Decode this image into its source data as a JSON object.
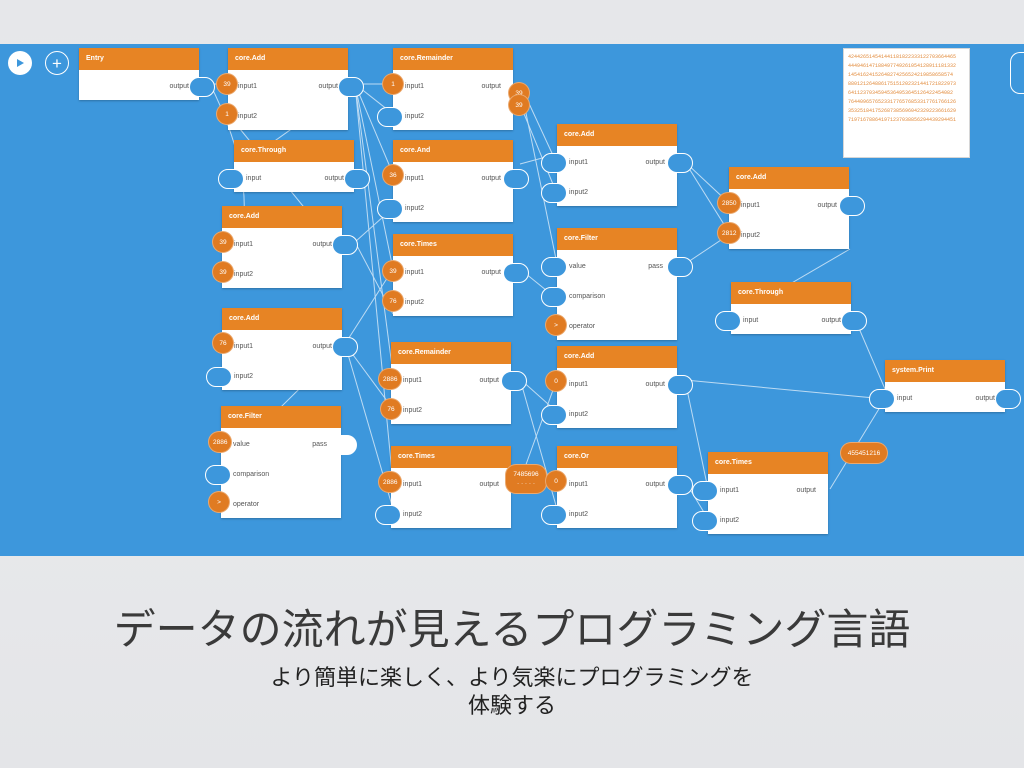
{
  "toolbar": {
    "play_label": "play",
    "add_label": "+"
  },
  "nodes": {
    "entry": {
      "title": "Entry",
      "out": "output"
    },
    "add1": {
      "title": "core.Add",
      "in1": "input1",
      "in2": "input2",
      "out": "output"
    },
    "through1": {
      "title": "core.Through",
      "in1": "input",
      "out": "output"
    },
    "add2": {
      "title": "core.Add",
      "in1": "input1",
      "in2": "input2",
      "out": "output"
    },
    "add3": {
      "title": "core.Add",
      "in1": "input1",
      "in2": "input2",
      "out": "output"
    },
    "filter1": {
      "title": "core.Filter",
      "in1": "value",
      "in2": "comparison",
      "in3": "operator",
      "out": "pass"
    },
    "rem1": {
      "title": "core.Remainder",
      "in1": "input1",
      "in2": "input2",
      "out": "output"
    },
    "and1": {
      "title": "core.And",
      "in1": "input1",
      "in2": "input2",
      "out": "output"
    },
    "times1": {
      "title": "core.Times",
      "in1": "input1",
      "in2": "input2",
      "out": "output"
    },
    "rem2": {
      "title": "core.Remainder",
      "in1": "input1",
      "in2": "input2",
      "out": "output"
    },
    "times2": {
      "title": "core.Times",
      "in1": "input1",
      "in2": "input2",
      "out": "output"
    },
    "add4": {
      "title": "core.Add",
      "in1": "input1",
      "in2": "input2",
      "out": "output"
    },
    "filter2": {
      "title": "core.Filter",
      "in1": "value",
      "in2": "comparison",
      "in3": "operator",
      "out": "pass"
    },
    "add5": {
      "title": "core.Add",
      "in1": "input1",
      "in2": "input2",
      "out": "output"
    },
    "or1": {
      "title": "core.Or",
      "in1": "input1",
      "in2": "input2",
      "out": "output"
    },
    "add6": {
      "title": "core.Add",
      "in1": "input1",
      "in2": "input2",
      "out": "output"
    },
    "through2": {
      "title": "core.Through",
      "in1": "input",
      "out": "output"
    },
    "times3": {
      "title": "core.Times",
      "in1": "input1",
      "in2": "input2",
      "out": "output"
    },
    "print": {
      "title": "system.Print",
      "in1": "input",
      "out": "output"
    }
  },
  "badges": {
    "add1_in1": "39",
    "add1_in2": "1",
    "add2_in1": "39",
    "add2_in2": "39",
    "add3_in1": "76",
    "filter1_in1": "2886",
    "filter1_in3": ">",
    "rem1_in1": "1",
    "rem1_out_a": "39",
    "rem1_out_b": "39",
    "and1_in1": "36",
    "times1_in1": "39",
    "times1_in2": "76",
    "rem2_in1": "2886",
    "rem2_in2": "76",
    "times2_in1": "2886",
    "times2_out_a": "7485696",
    "times2_out_b": "· · · · ·",
    "filter2_in3": ">",
    "add5_in1": "0",
    "or1_in1": "0",
    "add6_in1": "2850",
    "add6_in2": "2812",
    "print_value": "455451216"
  },
  "output_lines": [
    "42442651454144118182233312270366446​5",
    "44494614718849774926105412891118133​2",
    "14541624152648274256524219858658​574",
    "88012126488617515120232144172182297​3",
    "64112370345945364953645126422454082",
    "76440965765233177657685331776176612​6",
    "35325184175268738569604232922366162​9",
    "71971678864197123703885629443929445​1"
  ],
  "headline": "データの流れが見えるプログラミング言語",
  "subline1": "より簡単に楽しく、より気楽にプログラミングを",
  "subline2": "体験する",
  "colors": {
    "canvas": "#3d97dc",
    "node_header": "#e78424",
    "badge": "#e07b22",
    "output_text": "#e28a3a"
  }
}
